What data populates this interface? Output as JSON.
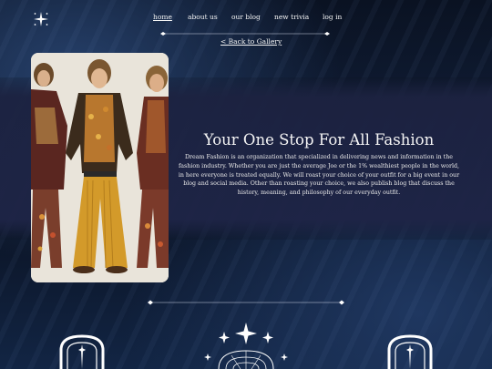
{
  "nav": {
    "items": [
      {
        "label": "home",
        "active": true
      },
      {
        "label": "about us",
        "active": false
      },
      {
        "label": "our blog",
        "active": false
      },
      {
        "label": "new trivia",
        "active": false
      },
      {
        "label": "log in",
        "active": false
      }
    ]
  },
  "back_link": "< Back to Gallery",
  "hero": {
    "title": "Your One Stop For All Fashion",
    "description": "Dream Fashion is an organization that specialized in delivering news and information in the fashion industry. Whether you are just the average Joe or the 1% wealthiest people in the world, in here everyone is treated equally. We will roast your choice of your outfit for a big event in our blog and social media. Other than roasting your choice, we also publish blog that discuss the history, meaning, and philosophy of our everyday outfit."
  },
  "icons": {
    "logo": "sparkle-logo-icon",
    "left_bottom": "arch-frame-icon",
    "center_bottom": "sparkle-sunburst-icon",
    "right_bottom": "arch-frame-icon"
  },
  "colors": {
    "background": "#0f1b33",
    "band": "#1e2446",
    "text": "#f2f2f2"
  }
}
